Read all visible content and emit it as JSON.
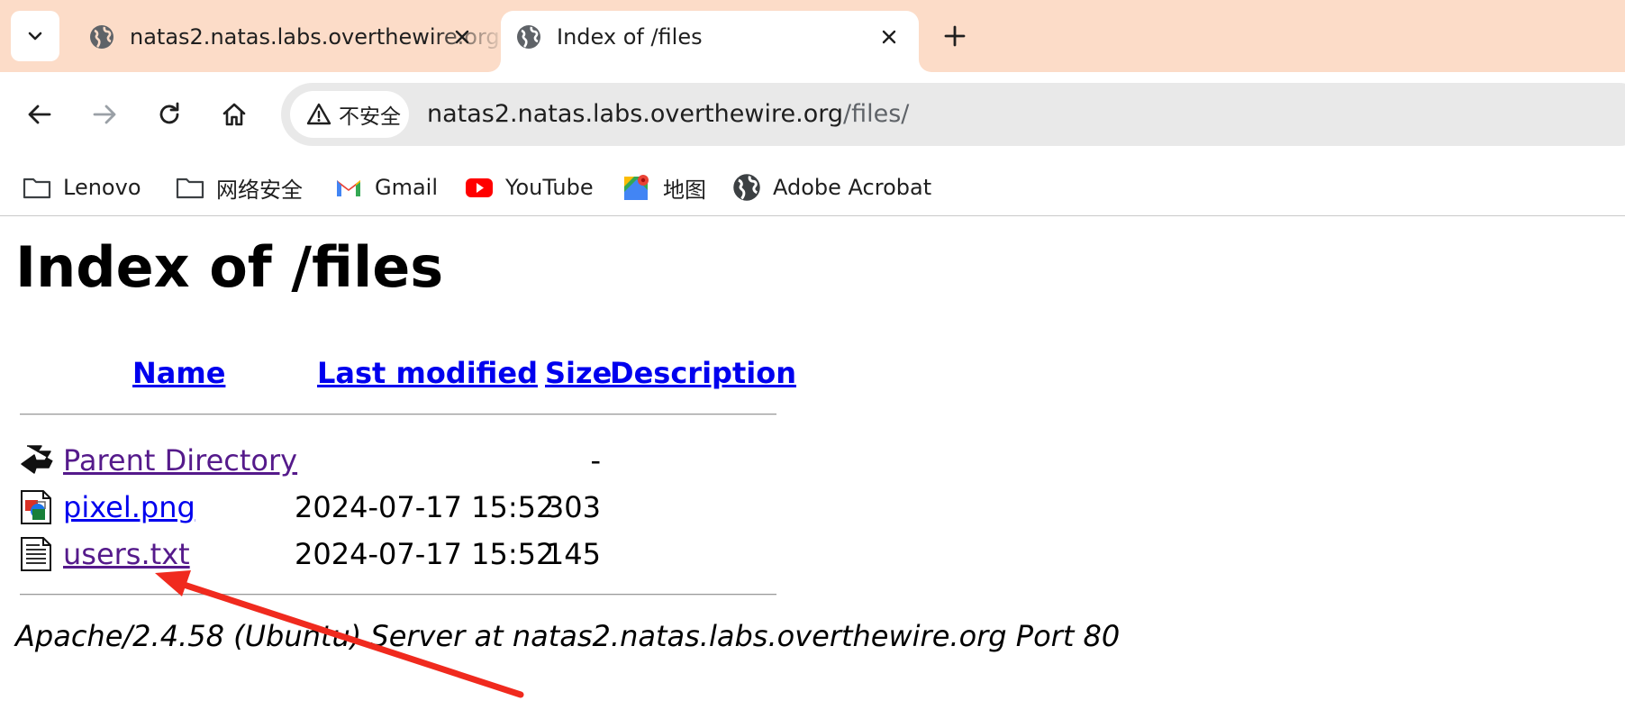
{
  "tabs": [
    {
      "title": "natas2.natas.labs.overthewire.org",
      "favicon": "globe-icon",
      "active": false
    },
    {
      "title": "Index of /files",
      "favicon": "globe-icon",
      "active": true
    }
  ],
  "toolbar": {
    "security_label": "不安全",
    "url_host": "natas2.natas.labs.overthewire.org",
    "url_path": "/files/"
  },
  "bookmarks": [
    {
      "label": "Lenovo",
      "icon": "folder-icon"
    },
    {
      "label": "网络安全",
      "icon": "folder-icon"
    },
    {
      "label": "Gmail",
      "icon": "gmail-icon"
    },
    {
      "label": "YouTube",
      "icon": "youtube-icon"
    },
    {
      "label": "地图",
      "icon": "maps-icon"
    },
    {
      "label": "Adobe Acrobat",
      "icon": "globe-icon"
    }
  ],
  "page": {
    "heading": "Index of /files",
    "columns": {
      "name": "Name",
      "modified": "Last modified",
      "size": "Size",
      "description": "Description"
    },
    "rows": [
      {
        "name": "Parent Directory",
        "modified": "",
        "size": "-",
        "icon": "back-folder-icon"
      },
      {
        "name": "pixel.png",
        "modified": "2024-07-17 15:52",
        "size": "303",
        "icon": "image-file-icon"
      },
      {
        "name": "users.txt",
        "modified": "2024-07-17 15:52",
        "size": "145",
        "icon": "text-file-icon"
      }
    ],
    "address": "Apache/2.4.58 (Ubuntu) Server at natas2.natas.labs.overthewire.org Port 80"
  },
  "colors": {
    "tabstrip": "#fcdcc8",
    "link": "#0000ee",
    "visited_link": "#551a8b",
    "annotation_arrow": "#f02a1e"
  }
}
